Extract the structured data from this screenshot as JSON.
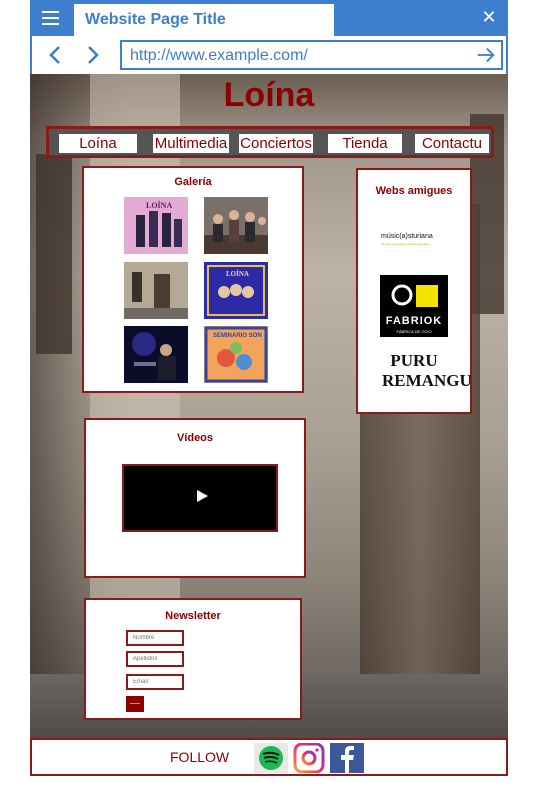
{
  "browser": {
    "tab_title": "Website Page Title",
    "url": "http://www.example.com/",
    "accent": "#3d7ecf"
  },
  "site": {
    "title": "Loína",
    "brand_color": "#8b0000",
    "nav": [
      "Loína",
      "Multimedia",
      "Conciertos",
      "Tienda",
      "Contactu"
    ]
  },
  "gallery": {
    "title": "Galería",
    "items": [
      "band-photo-pink",
      "band-acoustic-photo",
      "street-doorway-photo",
      "band-album-cover",
      "live-concert-photo",
      "seminario-son-cover"
    ]
  },
  "videos": {
    "title": "Vídeos"
  },
  "newsletter": {
    "title": "Newsletter",
    "fields": [
      {
        "placeholder": "Nombre"
      },
      {
        "placeholder": "Apellidos"
      },
      {
        "placeholder": "Email"
      }
    ]
  },
  "friends": {
    "title": "Webs amigues",
    "logos": [
      {
        "text": "músic(a)sturiana",
        "tagline": "pa que conozas la música asturiana"
      },
      {
        "text": "FABRIOK",
        "tagline": "FÁBRICA DE OCIO"
      },
      {
        "text": "PURU REMANGU"
      }
    ]
  },
  "footer": {
    "follow": "FOLLOW",
    "social": [
      "spotify-icon",
      "instagram-icon",
      "facebook-icon"
    ]
  }
}
